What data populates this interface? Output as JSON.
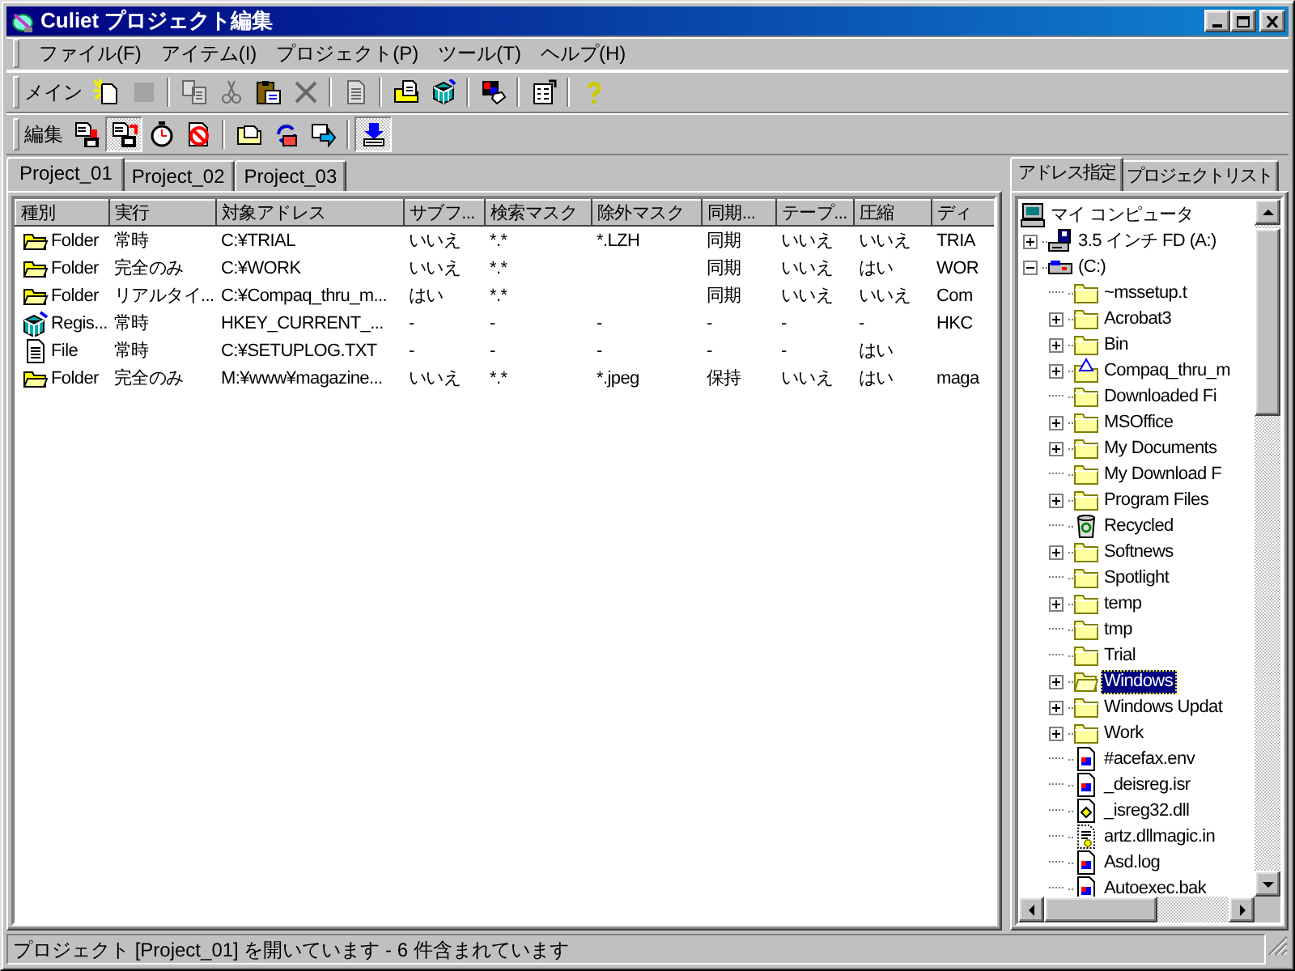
{
  "window": {
    "title": "Culiet プロジェクト編集"
  },
  "menu": [
    "ファイル(F)",
    "アイテム(I)",
    "プロジェクト(P)",
    "ツール(T)",
    "ヘルプ(H)"
  ],
  "toolbars": [
    {
      "label": "メイン",
      "items": [
        {
          "kind": "button",
          "disabled": false,
          "pressed": false
        },
        {
          "kind": "button",
          "disabled": true,
          "pressed": false
        },
        {
          "kind": "separator"
        },
        {
          "kind": "button",
          "disabled": true,
          "pressed": false
        },
        {
          "kind": "button",
          "disabled": true,
          "pressed": false
        },
        {
          "kind": "button",
          "disabled": false,
          "pressed": false
        },
        {
          "kind": "button",
          "disabled": true,
          "pressed": false
        },
        {
          "kind": "separator"
        },
        {
          "kind": "button",
          "disabled": true,
          "pressed": false
        },
        {
          "kind": "separator"
        },
        {
          "kind": "button",
          "disabled": false,
          "pressed": false
        },
        {
          "kind": "button",
          "disabled": false,
          "pressed": false
        },
        {
          "kind": "separator"
        },
        {
          "kind": "button",
          "disabled": false,
          "pressed": false
        },
        {
          "kind": "separator"
        },
        {
          "kind": "button",
          "disabled": false,
          "pressed": false
        },
        {
          "kind": "separator"
        },
        {
          "kind": "button",
          "disabled": false,
          "pressed": false
        }
      ]
    },
    {
      "label": "編集",
      "items": [
        {
          "kind": "button",
          "disabled": false,
          "pressed": false
        },
        {
          "kind": "button",
          "disabled": false,
          "pressed": true
        },
        {
          "kind": "button",
          "disabled": false,
          "pressed": false
        },
        {
          "kind": "button",
          "disabled": false,
          "pressed": false
        },
        {
          "kind": "separator"
        },
        {
          "kind": "button",
          "disabled": false,
          "pressed": false
        },
        {
          "kind": "button",
          "disabled": false,
          "pressed": false
        },
        {
          "kind": "button",
          "disabled": false,
          "pressed": false
        },
        {
          "kind": "separator"
        },
        {
          "kind": "button",
          "disabled": false,
          "pressed": true
        }
      ]
    }
  ],
  "project_tabs": [
    {
      "label": "Project_01",
      "selected": true
    },
    {
      "label": "Project_02",
      "selected": false
    },
    {
      "label": "Project_03",
      "selected": false
    }
  ],
  "table": {
    "columns": [
      "種別",
      "実行",
      "対象アドレス",
      "サブフ...",
      "検索マスク",
      "除外マスク",
      "同期...",
      "テープ...",
      "圧縮",
      "ディ"
    ],
    "rows": [
      {
        "kind": "folder",
        "cells": [
          "Folder",
          "常時",
          "C:¥TRIAL",
          "いいえ",
          "*.*",
          "*.LZH",
          "同期",
          "いいえ",
          "いいえ",
          "TRIA"
        ]
      },
      {
        "kind": "folder",
        "cells": [
          "Folder",
          "完全のみ",
          "C:¥WORK",
          "いいえ",
          "*.*",
          "",
          "同期",
          "いいえ",
          "はい",
          "WOR"
        ]
      },
      {
        "kind": "folder",
        "cells": [
          "Folder",
          "リアルタイ...",
          "C:¥Compaq_thru_m...",
          "はい",
          "*.*",
          "",
          "同期",
          "いいえ",
          "いいえ",
          "Com"
        ]
      },
      {
        "kind": "registry",
        "cells": [
          "Regis...",
          "常時",
          "HKEY_CURRENT_...",
          "-",
          "-",
          "-",
          "-",
          "-",
          "-",
          "HKC"
        ]
      },
      {
        "kind": "file",
        "cells": [
          "File",
          "常時",
          "C:¥SETUPLOG.TXT",
          "-",
          "-",
          "-",
          "-",
          "-",
          "はい",
          ""
        ]
      },
      {
        "kind": "folder",
        "cells": [
          "Folder",
          "完全のみ",
          "M:¥www¥magazine...",
          "いいえ",
          "*.*",
          "*.jpeg",
          "保持",
          "いいえ",
          "はい",
          "maga"
        ]
      }
    ]
  },
  "side_tabs": [
    {
      "label": "アドレス指定",
      "selected": true
    },
    {
      "label": "プロジェクトリスト",
      "selected": false
    }
  ],
  "tree": {
    "label": "マイ コンピュータ",
    "kind": "computer",
    "selected": false,
    "children": [
      {
        "label": "3.5 インチ FD (A:)",
        "kind": "floppy",
        "selected": false,
        "expanded": false
      },
      {
        "label": "(C:)",
        "kind": "drive",
        "selected": false,
        "expanded": true,
        "children": [
          {
            "label": "~mssetup.t",
            "kind": "folder",
            "selected": false
          },
          {
            "label": "Acrobat3",
            "kind": "folder",
            "selected": false,
            "expanded": false
          },
          {
            "label": "Bin",
            "kind": "folder",
            "selected": false,
            "expanded": false
          },
          {
            "label": "Compaq_thru_m",
            "kind": "web_folder",
            "selected": false,
            "expanded": false
          },
          {
            "label": "Downloaded Fi",
            "kind": "folder",
            "selected": false
          },
          {
            "label": "MSOffice",
            "kind": "folder",
            "selected": false,
            "expanded": false
          },
          {
            "label": "My Documents",
            "kind": "folder",
            "selected": false,
            "expanded": false
          },
          {
            "label": "My Download F",
            "kind": "folder",
            "selected": false
          },
          {
            "label": "Program Files",
            "kind": "folder",
            "selected": false,
            "expanded": false
          },
          {
            "label": "Recycled",
            "kind": "recycle",
            "selected": false
          },
          {
            "label": "Softnews",
            "kind": "folder",
            "selected": false,
            "expanded": false
          },
          {
            "label": "Spotlight",
            "kind": "folder",
            "selected": false
          },
          {
            "label": "temp",
            "kind": "folder",
            "selected": false,
            "expanded": false
          },
          {
            "label": "tmp",
            "kind": "folder",
            "selected": false
          },
          {
            "label": "Trial",
            "kind": "folder",
            "selected": false
          },
          {
            "label": "Windows",
            "kind": "folder",
            "selected": true,
            "expanded": false
          },
          {
            "label": "Windows Updat",
            "kind": "folder",
            "selected": false,
            "expanded": false
          },
          {
            "label": "Work",
            "kind": "folder",
            "selected": false,
            "expanded": false
          },
          {
            "label": "#acefax.env",
            "kind": "file",
            "selected": false
          },
          {
            "label": "_deisreg.isr",
            "kind": "file",
            "selected": false
          },
          {
            "label": "_isreg32.dll",
            "kind": "dll",
            "selected": false
          },
          {
            "label": "artz.dllmagic.in",
            "kind": "config",
            "selected": false
          },
          {
            "label": "Asd.log",
            "kind": "file",
            "selected": false
          },
          {
            "label": "Autoexec.bak",
            "kind": "file",
            "selected": false
          }
        ]
      }
    ]
  },
  "status_bar": "プロジェクト [Project_01] を開いています - 6 件含まれています"
}
